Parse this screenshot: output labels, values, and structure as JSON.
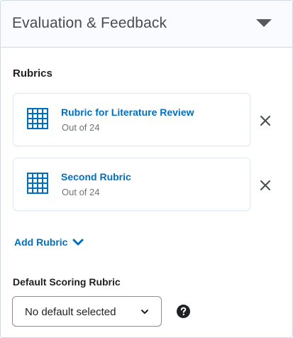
{
  "panel": {
    "title": "Evaluation & Feedback",
    "collapse_icon": "caret-down-icon"
  },
  "rubrics_section": {
    "label": "Rubrics",
    "items": [
      {
        "name": "Rubric for Literature Review",
        "score": "Out of 24",
        "icon": "grid-icon"
      },
      {
        "name": "Second Rubric",
        "score": "Out of 24",
        "icon": "grid-icon"
      }
    ],
    "remove_icon": "close-icon",
    "add_label": "Add Rubric",
    "add_icon": "chevron-down-icon"
  },
  "default_scoring": {
    "label": "Default Scoring Rubric",
    "selected": "No default selected",
    "help_icon": "help-icon"
  },
  "colors": {
    "link": "#006fbf",
    "text": "#202122",
    "muted": "#6e7376",
    "border": "#d3d9e3"
  }
}
